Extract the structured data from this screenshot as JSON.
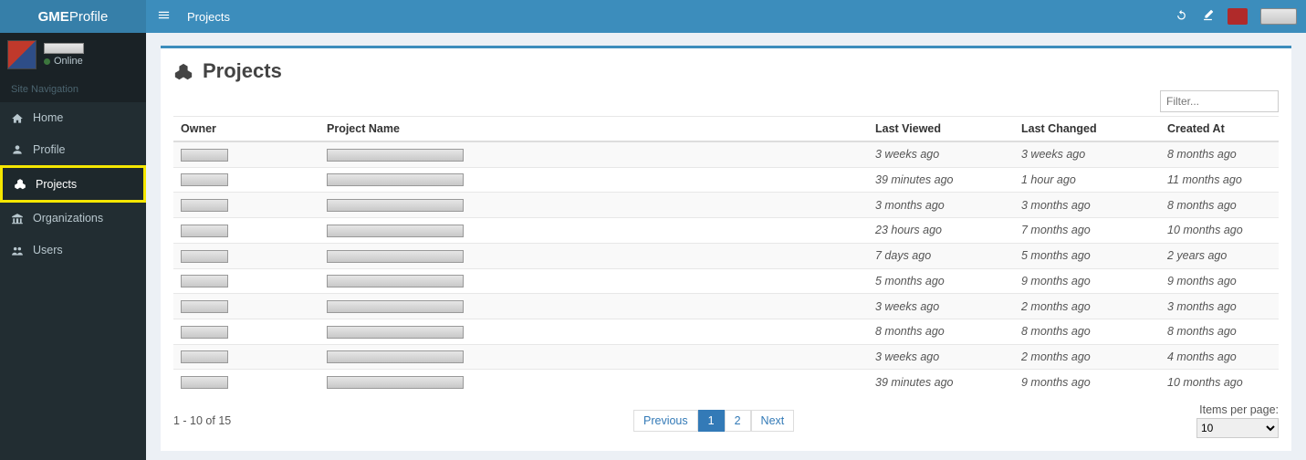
{
  "brand": {
    "bold": "GME",
    "light": "Profile"
  },
  "breadcrumb": "Projects",
  "user": {
    "status_label": "Online"
  },
  "sidebar": {
    "header": "Site Navigation",
    "items": [
      {
        "label": "Home"
      },
      {
        "label": "Profile"
      },
      {
        "label": "Projects"
      },
      {
        "label": "Organizations"
      },
      {
        "label": "Users"
      }
    ]
  },
  "page": {
    "title": "Projects"
  },
  "filter": {
    "placeholder": "Filter..."
  },
  "table": {
    "headers": {
      "owner": "Owner",
      "name": "Project Name",
      "viewed": "Last Viewed",
      "changed": "Last Changed",
      "created": "Created At"
    },
    "rows": [
      {
        "viewed": "3 weeks ago",
        "changed": "3 weeks ago",
        "created": "8 months ago"
      },
      {
        "viewed": "39 minutes ago",
        "changed": "1 hour ago",
        "created": "11 months ago"
      },
      {
        "viewed": "3 months ago",
        "changed": "3 months ago",
        "created": "8 months ago"
      },
      {
        "viewed": "23 hours ago",
        "changed": "7 months ago",
        "created": "10 months ago"
      },
      {
        "viewed": "7 days ago",
        "changed": "5 months ago",
        "created": "2 years ago"
      },
      {
        "viewed": "5 months ago",
        "changed": "9 months ago",
        "created": "9 months ago"
      },
      {
        "viewed": "3 weeks ago",
        "changed": "2 months ago",
        "created": "3 months ago"
      },
      {
        "viewed": "8 months ago",
        "changed": "8 months ago",
        "created": "8 months ago"
      },
      {
        "viewed": "3 weeks ago",
        "changed": "2 months ago",
        "created": "4 months ago"
      },
      {
        "viewed": "39 minutes ago",
        "changed": "9 months ago",
        "created": "10 months ago"
      }
    ]
  },
  "footer": {
    "range": "1 - 10 of 15",
    "previous": "Previous",
    "pages": [
      "1",
      "2"
    ],
    "next": "Next",
    "items_label": "Items per page:",
    "items_value": "10"
  }
}
